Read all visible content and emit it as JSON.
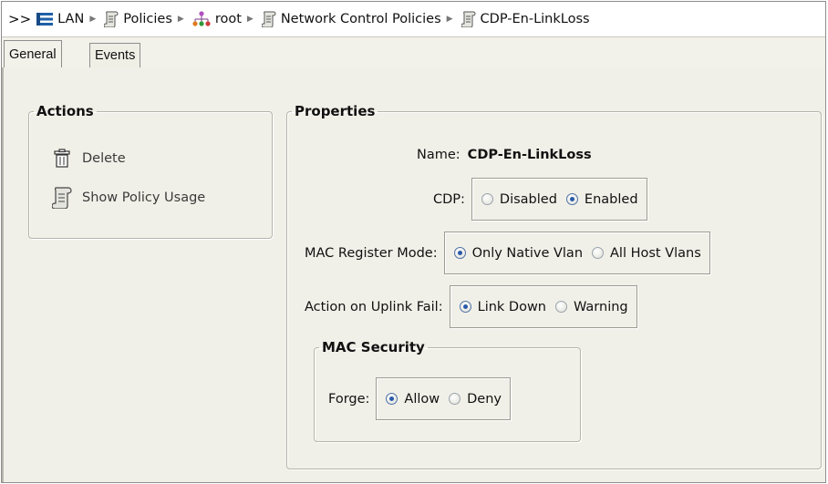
{
  "breadcrumb": {
    "prefix": ">>",
    "items": [
      {
        "label": "LAN",
        "icon": "lan-icon"
      },
      {
        "label": "Policies",
        "icon": "policy-scroll-icon"
      },
      {
        "label": "root",
        "icon": "org-tree-icon"
      },
      {
        "label": "Network Control Policies",
        "icon": "policy-scroll-icon"
      },
      {
        "label": "CDP-En-LinkLoss",
        "icon": "policy-scroll-icon"
      }
    ]
  },
  "tabs": [
    {
      "label": "General",
      "active": true
    },
    {
      "label": "Events",
      "active": false
    }
  ],
  "actions": {
    "title": "Actions",
    "items": [
      {
        "label": "Delete",
        "icon": "trash-icon"
      },
      {
        "label": "Show Policy Usage",
        "icon": "policy-scroll-icon"
      }
    ]
  },
  "properties": {
    "title": "Properties",
    "name_label": "Name:",
    "name_value": "CDP-En-LinkLoss",
    "cdp": {
      "label": "CDP:",
      "options": [
        "Disabled",
        "Enabled"
      ],
      "selected": "Enabled"
    },
    "mac_register_mode": {
      "label": "MAC Register Mode:",
      "options": [
        "Only Native Vlan",
        "All Host Vlans"
      ],
      "selected": "Only Native Vlan"
    },
    "uplink_fail": {
      "label": "Action on Uplink Fail:",
      "options": [
        "Link Down",
        "Warning"
      ],
      "selected": "Link Down"
    },
    "mac_security": {
      "title": "MAC Security",
      "forge": {
        "label": "Forge:",
        "options": [
          "Allow",
          "Deny"
        ],
        "selected": "Allow"
      }
    }
  },
  "colors": {
    "panel_bg": "#f1f0e8",
    "border": "#8e8e8e",
    "radio_selected": "#2a5aa8",
    "lan_icon": "#1f5fa8"
  }
}
